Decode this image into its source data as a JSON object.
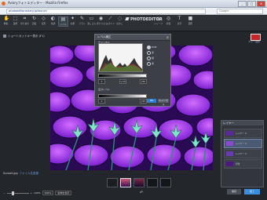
{
  "window": {
    "title": "Aviaryフォトエディター - Mozilla Firefox",
    "controls": [
      "_",
      "□",
      "×"
    ]
  },
  "address": {
    "url": "photoeditor.aviary.jp/launch",
    "search_placeholder": "Google"
  },
  "toolbar": {
    "tools": [
      {
        "label": "移動",
        "icon": "hand-icon"
      },
      {
        "label": "選択",
        "icon": "select-icon"
      },
      {
        "label": "切り抜き",
        "icon": "crop-icon"
      },
      {
        "label": "回転",
        "icon": "rotate-icon"
      },
      {
        "label": "変形",
        "icon": "transform-icon"
      },
      {
        "label": "色調",
        "icon": "color-icon"
      },
      {
        "label": "レベル",
        "icon": "levels-icon"
      },
      {
        "label": "効果",
        "icon": "effects-icon"
      },
      {
        "label": "ブラシ",
        "icon": "brush-icon"
      },
      {
        "label": "消しゴム",
        "icon": "eraser-icon"
      },
      {
        "label": "塗りつぶし",
        "icon": "fill-icon"
      },
      {
        "label": "スポイト",
        "icon": "eyedropper-icon"
      },
      {
        "label": "ぼかし",
        "icon": "blur-icon"
      },
      {
        "label": "シャープ",
        "icon": "sharpen-icon"
      },
      {
        "label": "赤目",
        "icon": "redeye-icon"
      },
      {
        "label": "文字",
        "icon": "text-icon"
      },
      {
        "label": "図形",
        "icon": "shape-icon"
      }
    ],
    "logo": "PHOTOEDITOR",
    "color_label": "カラー選択"
  },
  "file_title": "ショートカットキー表示 (F1)",
  "levels_dialog": {
    "title": "レベル補正",
    "channel_label": "チャンネル",
    "options": [
      "RGB",
      "赤",
      "緑",
      "青"
    ],
    "input_label": "入力レベル",
    "output_label": "出力レベル",
    "input_values": [
      "0",
      "1.00",
      "255"
    ],
    "output_values": [
      "0",
      "255"
    ],
    "ok_label": "OK",
    "cancel_label": "キャンセル"
  },
  "layers_panel": {
    "title": "レイヤー",
    "items": [
      {
        "name": "レイヤー 5"
      },
      {
        "name": "レイヤー 4"
      },
      {
        "name": "レイヤー 3"
      },
      {
        "name": "背景"
      }
    ]
  },
  "bottom": {
    "filename": "Sunset.jpg",
    "file_sub": "ファイル名変更",
    "zoom_value": "100%",
    "zoom_fit": "100%",
    "zoom_fit2": "全体を表示",
    "save_label": "保存",
    "done_label": "完了"
  },
  "colors": {
    "accent": "#3a8ee0",
    "primary_color": "#c0282a"
  }
}
